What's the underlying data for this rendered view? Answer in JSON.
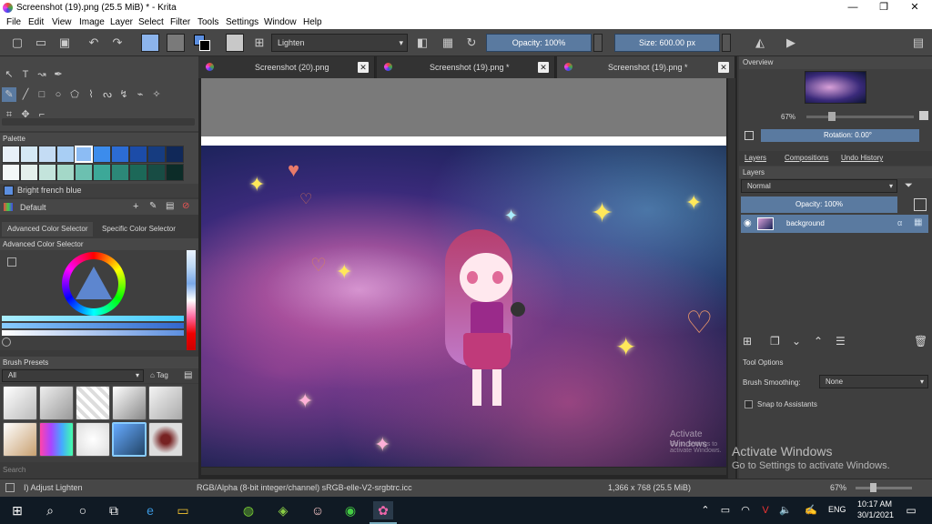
{
  "window": {
    "title": "Screenshot (19).png (25.5 MiB)  * - Krita",
    "controls": {
      "minimize": "—",
      "maximize": "❐",
      "close": "✕"
    }
  },
  "menu": [
    "File",
    "Edit",
    "View",
    "Image",
    "Layer",
    "Select",
    "Filter",
    "Tools",
    "Settings",
    "Window",
    "Help"
  ],
  "toolbar": {
    "blend_mode": "Lighten",
    "opacity": "Opacity: 100%",
    "size": "Size: 600.00 px"
  },
  "palette": {
    "title": "Palette",
    "selected_color_name": "Bright french blue",
    "palette_name": "Default",
    "colors_row1": [
      "#e8f0f8",
      "#d4e8f4",
      "#c4dcf4",
      "#a8cef4",
      "#8cbcf4",
      "#3c8cec",
      "#2c6cd4",
      "#1c4ca8",
      "#163c80",
      "#102858"
    ],
    "colors_row2": [
      "#f4f8f8",
      "#e4f0ec",
      "#c4e4dc",
      "#a4d8c8",
      "#6cc0b0",
      "#3ca898",
      "#2c8878",
      "#1c6858",
      "#184c44",
      "#0c2c28"
    ]
  },
  "color_selector": {
    "tab_advanced": "Advanced Color Selector",
    "tab_specific": "Specific Color Selector",
    "title": "Advanced Color Selector"
  },
  "brush_presets": {
    "title": "Brush Presets",
    "filter": "All",
    "tag": "Tag",
    "search_placeholder": "Search"
  },
  "documents": {
    "tabs": [
      "Screenshot (20).png",
      "Screenshot (19).png *",
      "Screenshot (19).png *"
    ]
  },
  "canvas": {
    "watermark_small": "Activate Windows",
    "watermark_small2": "Go to Settings to activate Windows."
  },
  "overview": {
    "title": "Overview",
    "zoom": "67%",
    "rotation": "Rotation: 0.00°"
  },
  "layers": {
    "tabs": [
      "Layers",
      "Compositions",
      "Undo History"
    ],
    "title": "Layers",
    "blend": "Normal",
    "opacity": "Opacity: 100%",
    "layer_name": "background"
  },
  "tool_options": {
    "title": "Tool Options",
    "smoothing_label": "Brush Smoothing:",
    "smoothing_value": "None",
    "snap_label": "Snap to Assistants"
  },
  "status": {
    "tool": "I) Adjust Lighten",
    "color_space": "RGB/Alpha (8-bit integer/channel)  sRGB-elle-V2-srgbtrc.icc",
    "image_size": "1,366 x 768 (25.5 MiB)",
    "zoom": "67%"
  },
  "activate": {
    "line1": "Activate Windows",
    "line2": "Go to Settings to activate Windows."
  },
  "taskbar": {
    "language": "ENG",
    "time": "10:17 AM",
    "date": "30/1/2021"
  }
}
